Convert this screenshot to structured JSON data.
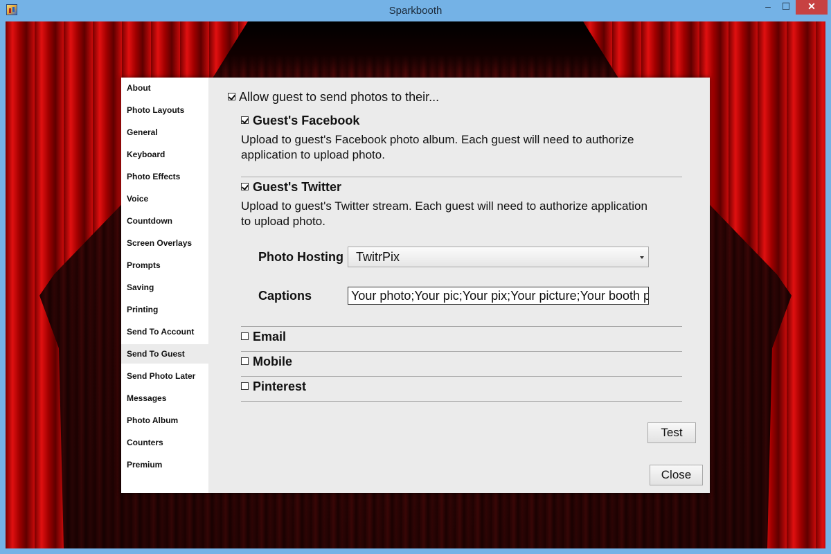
{
  "window": {
    "title": "Sparkbooth",
    "minimize": "‒",
    "maximize": "☐",
    "close": "✕"
  },
  "sidebar": {
    "items": [
      {
        "label": "About"
      },
      {
        "label": "Photo Layouts"
      },
      {
        "label": "General"
      },
      {
        "label": "Keyboard"
      },
      {
        "label": "Photo Effects"
      },
      {
        "label": "Voice"
      },
      {
        "label": "Countdown"
      },
      {
        "label": "Screen Overlays"
      },
      {
        "label": "Prompts"
      },
      {
        "label": "Saving"
      },
      {
        "label": "Printing"
      },
      {
        "label": "Send To Account"
      },
      {
        "label": "Send To Guest"
      },
      {
        "label": "Send Photo Later"
      },
      {
        "label": "Messages"
      },
      {
        "label": "Photo Album"
      },
      {
        "label": "Counters"
      },
      {
        "label": "Premium"
      }
    ],
    "active": "Send To Guest"
  },
  "content": {
    "allow_label": "Allow guest to send photos to their...",
    "allow_checked": true,
    "facebook": {
      "title": "Guest's Facebook",
      "checked": true,
      "desc_line1": "Upload to guest's Facebook photo album. Each guest will need to authorize",
      "desc_line2": "application to upload photo."
    },
    "twitter": {
      "title": "Guest's Twitter",
      "checked": true,
      "desc_line1": "Upload to guest's Twitter stream. Each guest will need to authorize application",
      "desc_line2": "to upload photo."
    },
    "photo_hosting": {
      "label": "Photo Hosting",
      "value": "TwitrPix"
    },
    "captions": {
      "label": "Captions",
      "value": "Your photo;Your pic;Your pix;Your picture;Your booth p"
    },
    "email": {
      "title": "Email",
      "checked": false
    },
    "mobile": {
      "title": "Mobile",
      "checked": false
    },
    "pinterest": {
      "title": "Pinterest",
      "checked": false
    },
    "test_button": "Test",
    "close_button": "Close"
  },
  "colors": {
    "titlebar": "#74b2e6",
    "dialog_bg": "#ebebeb",
    "sidebar_bg": "#ffffff",
    "curtain": "#c80a0a",
    "close_button": "#c74242"
  }
}
